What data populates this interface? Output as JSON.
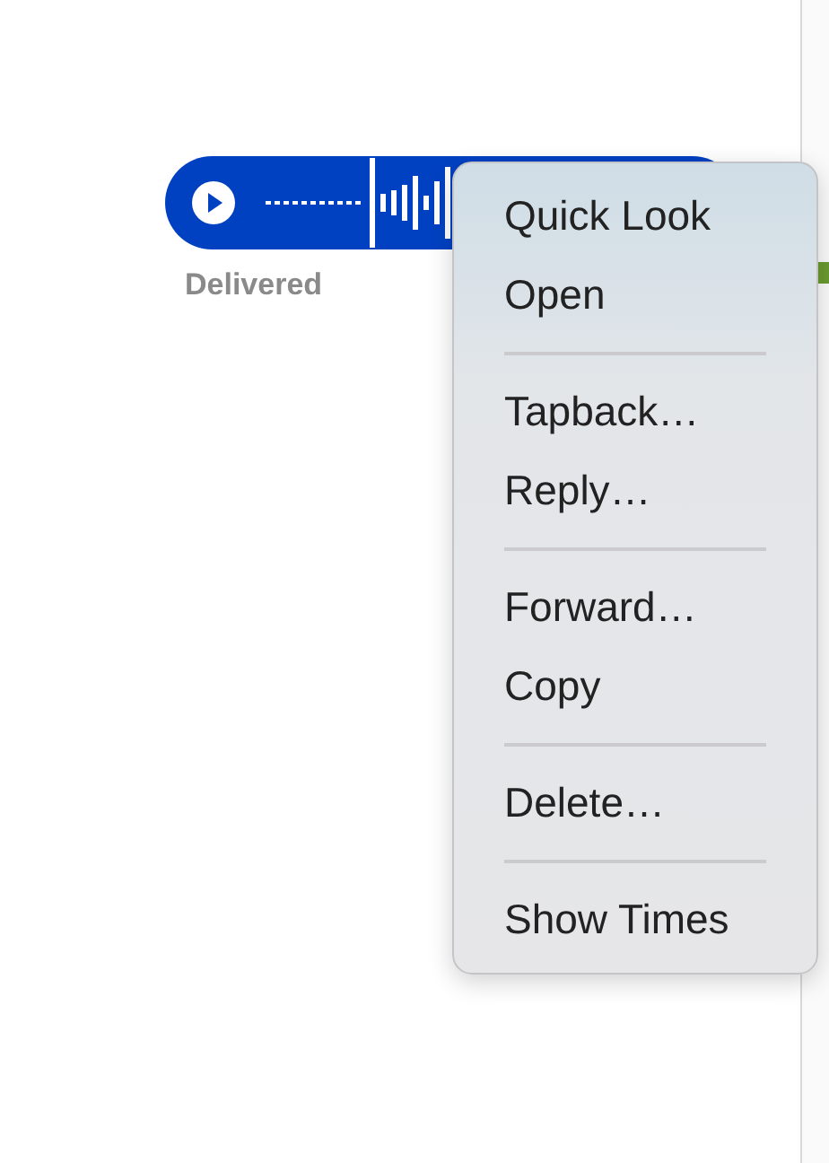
{
  "message": {
    "status": "Delivered"
  },
  "context_menu": {
    "groups": [
      {
        "items": [
          "Quick Look",
          "Open"
        ]
      },
      {
        "items": [
          "Tapback…",
          "Reply…"
        ]
      },
      {
        "items": [
          "Forward…",
          "Copy"
        ]
      },
      {
        "items": [
          "Delete…"
        ]
      },
      {
        "items": [
          "Show Times"
        ]
      }
    ]
  }
}
